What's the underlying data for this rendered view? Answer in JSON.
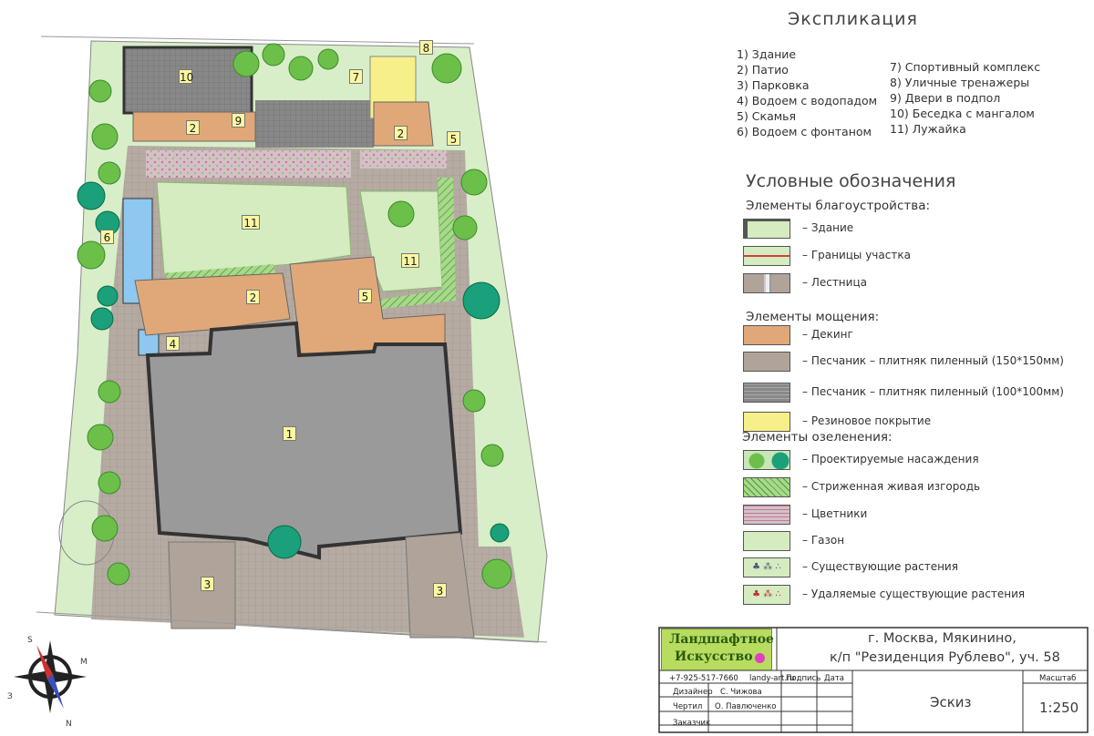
{
  "explication": {
    "title": "Экспликация",
    "items_left": [
      "1) Здание",
      "2) Патио",
      "3) Парковка",
      "4) Водоем с водопадом",
      "5) Скамья",
      "6) Водоем с фонтаном"
    ],
    "items_right": [
      "7) Спортивный комплекс",
      "8) Уличные тренажеры",
      "9) Двери в подпол",
      "10) Беседка с мангалом",
      "11) Лужайка"
    ]
  },
  "legend": {
    "title": "Условные обозначения",
    "sections": [
      {
        "title": "Элементы благоустройства:",
        "items": [
          {
            "label": "– Здание",
            "kind": "building"
          },
          {
            "label": "– Границы участка",
            "kind": "boundary"
          },
          {
            "label": "– Лестница",
            "kind": "stairs"
          }
        ]
      },
      {
        "title": "Элементы мощения:",
        "items": [
          {
            "label": "– Декинг",
            "kind": "decking"
          },
          {
            "label": "– Песчаник – плитняк пиленный (150*150мм)",
            "kind": "sand150"
          },
          {
            "label": "– Песчаник – плитняк пиленный (100*100мм)",
            "kind": "sand100"
          },
          {
            "label": "– Резиновое покрытие",
            "kind": "rubber"
          }
        ]
      },
      {
        "title": "Элементы озеленения:",
        "items": [
          {
            "label": "– Проектируемые насаждения",
            "kind": "plants"
          },
          {
            "label": "– Стриженная живая изгородь",
            "kind": "hedge"
          },
          {
            "label": "– Цветники",
            "kind": "flowers"
          },
          {
            "label": "– Газон",
            "kind": "lawn"
          },
          {
            "label": "– Существующие растения",
            "kind": "existing"
          },
          {
            "label": "– Удаляемые существующие растения",
            "kind": "removed"
          }
        ]
      }
    ]
  },
  "plan_numbers": [
    {
      "id": "10",
      "label": "10"
    },
    {
      "id": "7",
      "label": "7"
    },
    {
      "id": "8",
      "label": "8"
    },
    {
      "id": "2a",
      "label": "2"
    },
    {
      "id": "9",
      "label": "9"
    },
    {
      "id": "2b",
      "label": "2"
    },
    {
      "id": "5a",
      "label": "5"
    },
    {
      "id": "11a",
      "label": "11"
    },
    {
      "id": "11b",
      "label": "11"
    },
    {
      "id": "6",
      "label": "6"
    },
    {
      "id": "2c",
      "label": "2"
    },
    {
      "id": "5b",
      "label": "5"
    },
    {
      "id": "4",
      "label": "4"
    },
    {
      "id": "1",
      "label": "1"
    },
    {
      "id": "3a",
      "label": "3"
    },
    {
      "id": "3b",
      "label": "3"
    }
  ],
  "titleblock": {
    "logo_line1": "Ландшафтное",
    "logo_line2": "Искусство",
    "address_line1": "г. Москва, Мякинино,",
    "address_line2": "к/п \"Резиденция Рублево\", уч. 58",
    "phone": "+7-925-517-7660",
    "site": "landy-art.ru",
    "col_sign": "Подпись",
    "col_date": "Дата",
    "row_designer_label": "Дизайнер",
    "row_designer_name": "С. Чижова",
    "row_draft_label": "Чертил",
    "row_draft_name": "О. Павлюченко",
    "row_client_label": "Заказчик",
    "sheet": "Эскиз",
    "scale_label": "Масштаб",
    "scale_value": "1:250"
  },
  "compass": {
    "north": "N",
    "south": "S",
    "east": "M",
    "west": "З"
  },
  "colors": {
    "lawn": "#d4ecc0",
    "decking": "#e0a878",
    "building": "#9a9a9a",
    "sand": "#b0a49a",
    "rubber": "#f7f08a",
    "water": "#8ec8f0",
    "hedge": "#a8d88a",
    "flower": "#d8a8c0",
    "tree": "#6cc04a",
    "conifer": "#1aa07a",
    "logo_bg": "#b8dc60",
    "logo_dot": "#e040c0"
  }
}
